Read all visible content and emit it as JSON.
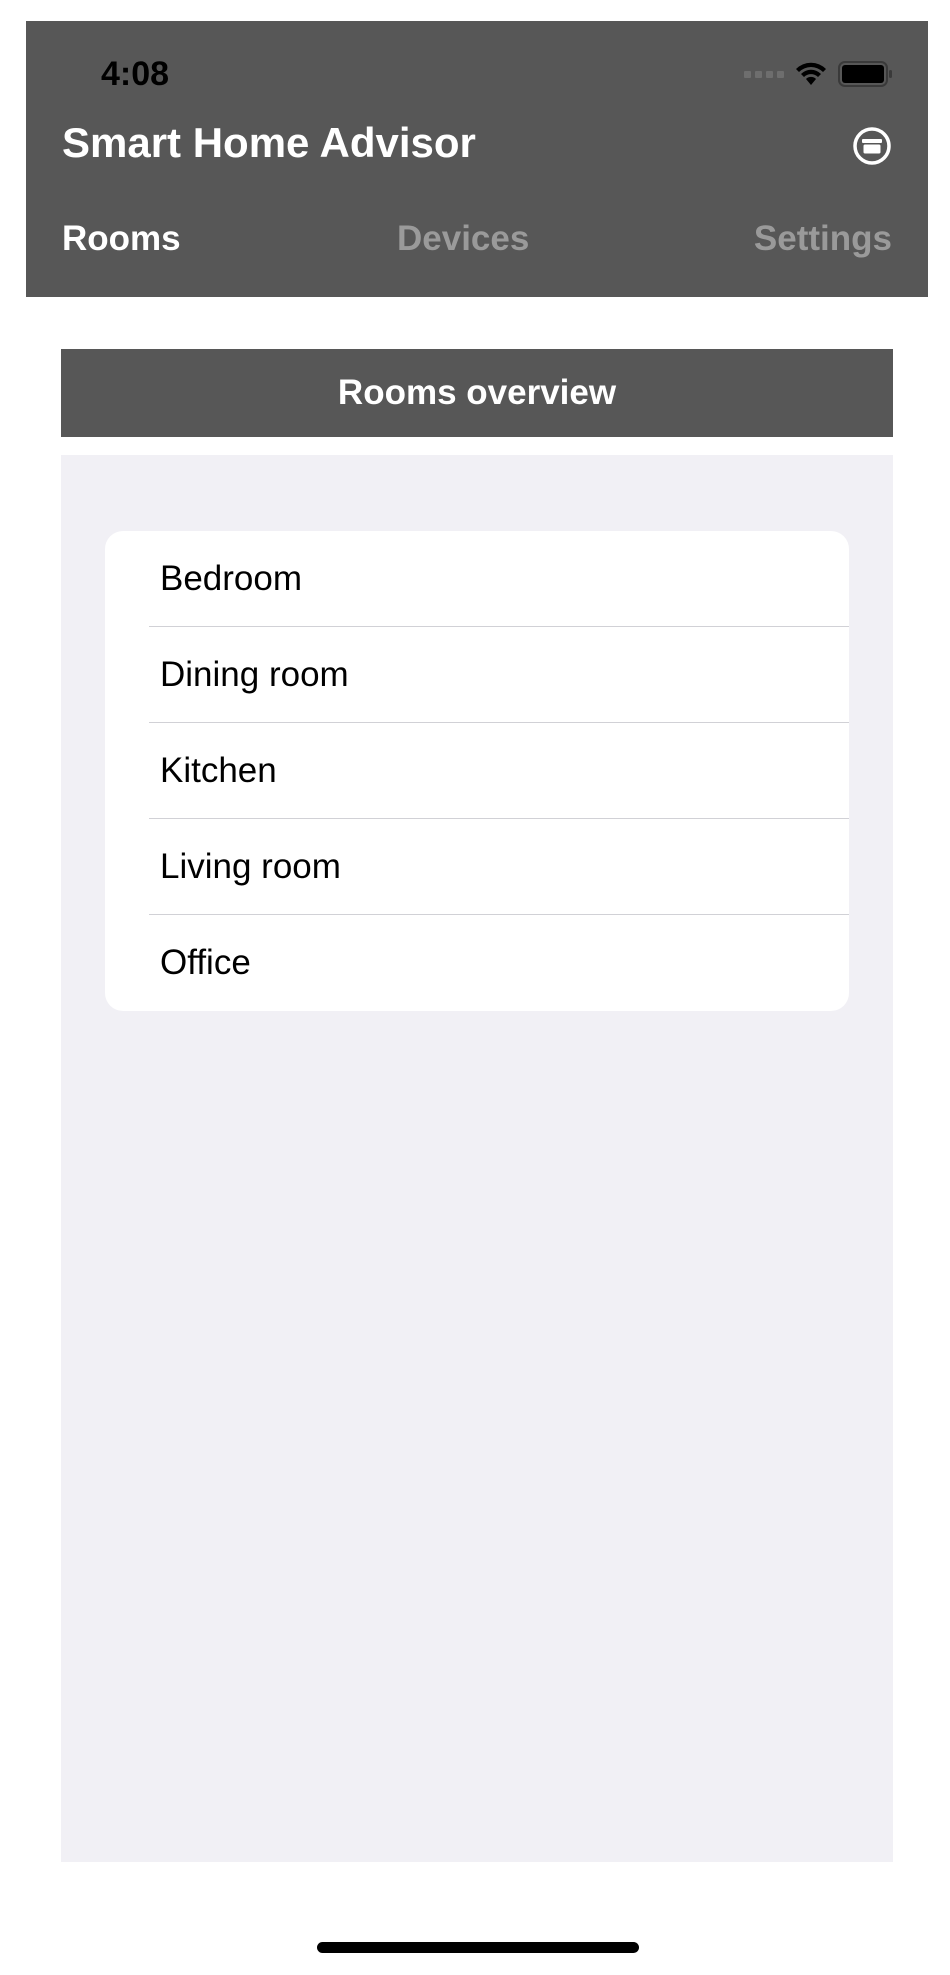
{
  "status_bar": {
    "time": "4:08"
  },
  "header": {
    "title": "Smart Home Advisor",
    "action_icon": "archive-circle-icon",
    "tabs": [
      {
        "label": "Rooms",
        "active": true
      },
      {
        "label": "Devices",
        "active": false
      },
      {
        "label": "Settings",
        "active": false
      }
    ]
  },
  "section": {
    "title": "Rooms overview"
  },
  "rooms": [
    {
      "label": "Bedroom"
    },
    {
      "label": "Dining room"
    },
    {
      "label": "Kitchen"
    },
    {
      "label": "Living room"
    },
    {
      "label": "Office"
    }
  ],
  "colors": {
    "header_bg": "#575757",
    "content_bg": "#f1f0f5",
    "inactive_tab": "#9a9a9a"
  }
}
